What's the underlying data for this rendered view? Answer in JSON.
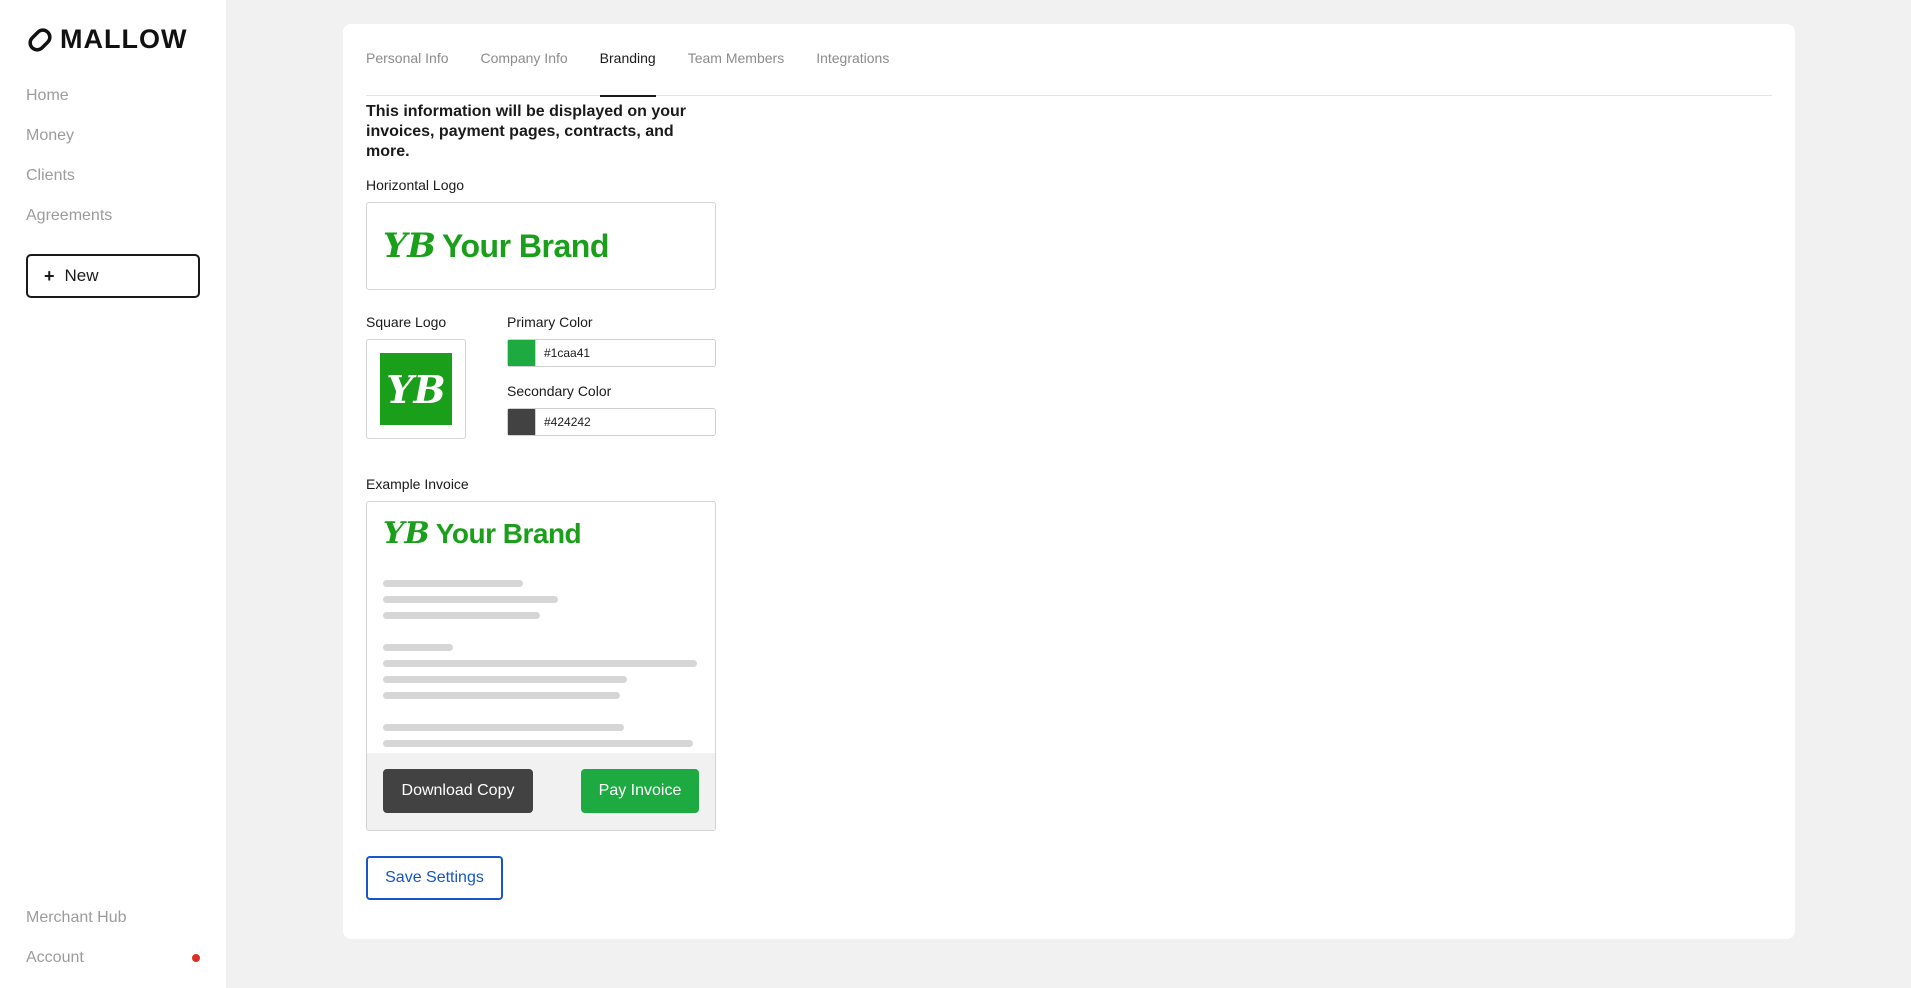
{
  "app": {
    "name": "MALLOW",
    "logo_icon": "mallow-logo-icon"
  },
  "sidebar": {
    "items": [
      {
        "label": "Home"
      },
      {
        "label": "Money"
      },
      {
        "label": "Clients"
      },
      {
        "label": "Agreements"
      }
    ],
    "new_button": {
      "icon": "+",
      "label": "New"
    },
    "bottom_items": [
      {
        "label": "Merchant Hub"
      },
      {
        "label": "Account",
        "has_notification": true
      }
    ]
  },
  "tabs": [
    {
      "label": "Personal Info",
      "active": false
    },
    {
      "label": "Company Info",
      "active": false
    },
    {
      "label": "Branding",
      "active": true
    },
    {
      "label": "Team Members",
      "active": false
    },
    {
      "label": "Integrations",
      "active": false
    }
  ],
  "branding": {
    "intro": "This information will be displayed on your invoices, payment pages, contracts, and more.",
    "horizontal_logo_label": "Horizontal Logo",
    "square_logo_label": "Square Logo",
    "brand_mark": "YB",
    "brand_name": "Your Brand",
    "primary_color_label": "Primary Color",
    "primary_color_value": "#1caa41",
    "secondary_color_label": "Secondary Color",
    "secondary_color_value": "#424242",
    "example_invoice_label": "Example Invoice",
    "download_button": "Download Copy",
    "pay_button": "Pay Invoice",
    "save_button": "Save Settings"
  },
  "colors": {
    "primary": "#1caa41",
    "secondary": "#424242",
    "brand_logo_green": "#1a9f1a",
    "save_button_blue": "#1656c7",
    "notification_red": "#d93025"
  }
}
